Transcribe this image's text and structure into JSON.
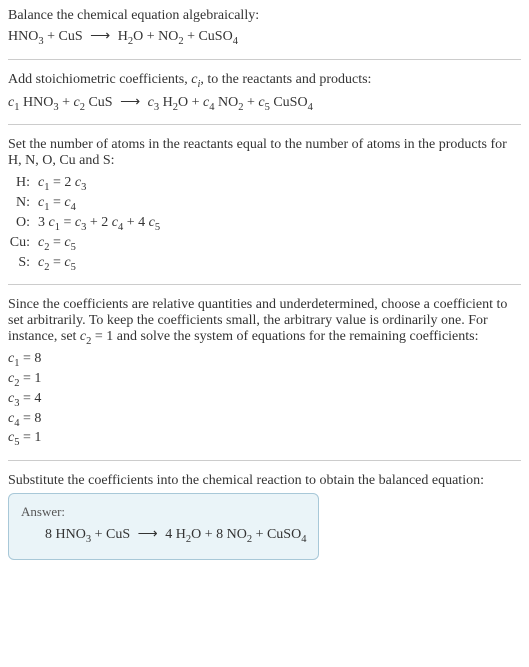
{
  "intro": {
    "line1": "Balance the chemical equation algebraically:",
    "equation_text": "HNO₃ + CuS ⟶ H₂O + NO₂ + CuSO₄"
  },
  "stoich": {
    "line1_a": "Add stoichiometric coefficients, ",
    "line1_ci": "c",
    "line1_ci_sub": "i",
    "line1_b": ", to the reactants and products:",
    "equation_text": "c₁ HNO₃ + c₂ CuS ⟶ c₃ H₂O + c₄ NO₂ + c₅ CuSO₄"
  },
  "atoms": {
    "intro": "Set the number of atoms in the reactants equal to the number of atoms in the products for H, N, O, Cu and S:",
    "rows": [
      {
        "label": "H:",
        "eq": "c₁ = 2 c₃"
      },
      {
        "label": "N:",
        "eq": "c₁ = c₄"
      },
      {
        "label": "O:",
        "eq": "3 c₁ = c₃ + 2 c₄ + 4 c₅"
      },
      {
        "label": "Cu:",
        "eq": "c₂ = c₅"
      },
      {
        "label": "S:",
        "eq": "c₂ = c₅"
      }
    ]
  },
  "solve": {
    "intro": "Since the coefficients are relative quantities and underdetermined, choose a coefficient to set arbitrarily. To keep the coefficients small, the arbitrary value is ordinarily one. For instance, set c₂ = 1 and solve the system of equations for the remaining coefficients:",
    "coefs": [
      "c₁ = 8",
      "c₂ = 1",
      "c₃ = 4",
      "c₄ = 8",
      "c₅ = 1"
    ]
  },
  "substitute": {
    "intro": "Substitute the coefficients into the chemical reaction to obtain the balanced equation:"
  },
  "answer": {
    "label": "Answer:",
    "equation_text": "8 HNO₃ + CuS ⟶ 4 H₂O + 8 NO₂ + CuSO₄"
  },
  "chart_data": {
    "type": "table",
    "title": "Balanced chemical equation coefficients",
    "reactants": [
      {
        "species": "HNO3",
        "coefficient": 8
      },
      {
        "species": "CuS",
        "coefficient": 1
      }
    ],
    "products": [
      {
        "species": "H2O",
        "coefficient": 4
      },
      {
        "species": "NO2",
        "coefficient": 8
      },
      {
        "species": "CuSO4",
        "coefficient": 1
      }
    ],
    "atom_balance": [
      {
        "element": "H",
        "equation": "c1 = 2 c3"
      },
      {
        "element": "N",
        "equation": "c1 = c4"
      },
      {
        "element": "O",
        "equation": "3 c1 = c3 + 2 c4 + 4 c5"
      },
      {
        "element": "Cu",
        "equation": "c2 = c5"
      },
      {
        "element": "S",
        "equation": "c2 = c5"
      }
    ],
    "solved_coefficients": {
      "c1": 8,
      "c2": 1,
      "c3": 4,
      "c4": 8,
      "c5": 1
    }
  }
}
